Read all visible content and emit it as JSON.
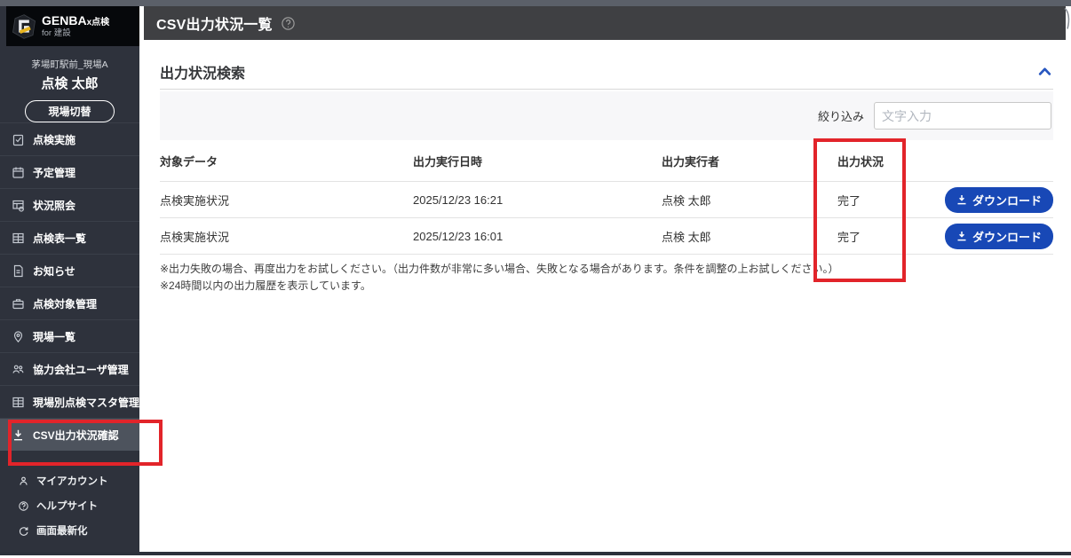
{
  "app": {
    "brand": "GENBA",
    "brand_suffix": "x点検",
    "brand_sub": "for 建設"
  },
  "header": {
    "title": "CSV出力状況一覧"
  },
  "sidebar": {
    "site_label": "茅場町駅前_現場A",
    "user_name": "点検 太郎",
    "switch_site_button": "現場切替",
    "items": [
      {
        "label": "点検実施",
        "icon": "clipboard-check-icon"
      },
      {
        "label": "予定管理",
        "icon": "calendar-icon"
      },
      {
        "label": "状況照会",
        "icon": "status-table-icon"
      },
      {
        "label": "点検表一覧",
        "icon": "table-icon"
      },
      {
        "label": "お知らせ",
        "icon": "document-icon"
      },
      {
        "label": "点検対象管理",
        "icon": "briefcase-icon"
      },
      {
        "label": "現場一覧",
        "icon": "map-pin-icon"
      },
      {
        "label": "協力会社ユーザ管理",
        "icon": "users-icon"
      },
      {
        "label": "現場別点検マスタ管理",
        "icon": "grid-icon"
      },
      {
        "label": "CSV出力状況確認",
        "icon": "download-icon",
        "active": true
      }
    ],
    "secondary_items": [
      {
        "label": "マイアカウント",
        "icon": "person-icon"
      },
      {
        "label": "ヘルプサイト",
        "icon": "help-icon"
      },
      {
        "label": "画面最新化",
        "icon": "refresh-icon"
      }
    ]
  },
  "search_panel": {
    "title": "出力状況検索",
    "filter_label": "絞り込み",
    "filter_placeholder": "文字入力",
    "collapse_icon": "chevron-up-icon"
  },
  "table": {
    "columns": [
      "対象データ",
      "出力実行日時",
      "出力実行者",
      "出力状況"
    ],
    "rows": [
      {
        "target_data": "点検実施状況",
        "executed_at": "2025/12/23 16:21",
        "executor": "点検 太郎",
        "status": "完了",
        "action_label": "ダウンロード"
      },
      {
        "target_data": "点検実施状況",
        "executed_at": "2025/12/23 16:01",
        "executor": "点検 太郎",
        "status": "完了",
        "action_label": "ダウンロード"
      }
    ]
  },
  "notes": [
    "※出力失敗の場合、再度出力をお試しください。（出力件数が非常に多い場合、失敗となる場合があります。条件を調整の上お試しください。）",
    "※24時間以内の出力履歴を表示しています。"
  ],
  "colors": {
    "accent_blue": "#1848b6",
    "annotation_red": "#e2242a",
    "brand_yellow": "#e7b41f",
    "sidebar_bg": "#2e323c",
    "header_bg": "#3f4043"
  }
}
